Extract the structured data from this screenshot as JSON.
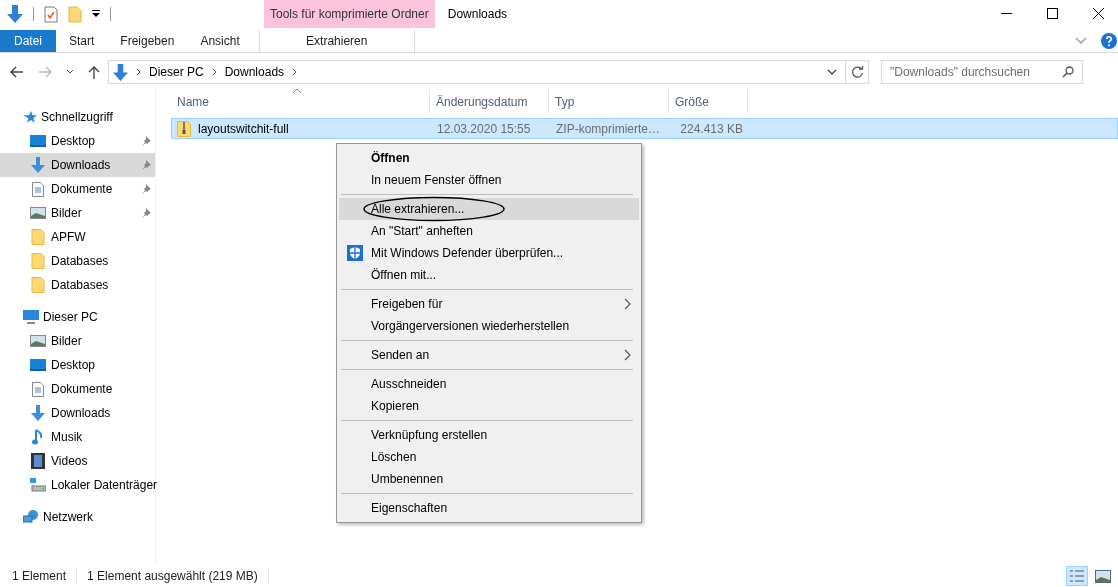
{
  "window": {
    "title": "Downloads"
  },
  "ribbon": {
    "tabs": [
      {
        "label": "Datei",
        "kind": "file",
        "selected": false
      },
      {
        "label": "Start",
        "kind": "tab",
        "selected": false
      },
      {
        "label": "Freigeben",
        "kind": "tab",
        "selected": false
      },
      {
        "label": "Ansicht",
        "kind": "tab",
        "selected": false
      }
    ],
    "contextual": {
      "group_label": "Tools für komprimierte Ordner",
      "tab": "Extrahieren"
    }
  },
  "address": {
    "path": [
      "Dieser PC",
      "Downloads"
    ]
  },
  "search": {
    "placeholder": "\"Downloads\" durchsuchen"
  },
  "sidebar": {
    "groups": [
      {
        "label": "Schnellzugriff",
        "kind": "star",
        "children": [
          {
            "label": "Desktop",
            "kind": "desktop",
            "pinned": true,
            "selected": false
          },
          {
            "label": "Downloads",
            "kind": "download",
            "pinned": true,
            "selected": true
          },
          {
            "label": "Dokumente",
            "kind": "document",
            "pinned": true,
            "selected": false
          },
          {
            "label": "Bilder",
            "kind": "pictures",
            "pinned": true,
            "selected": false
          },
          {
            "label": "APFW",
            "kind": "folder",
            "pinned": false,
            "selected": false
          },
          {
            "label": "Databases",
            "kind": "folder",
            "pinned": false,
            "selected": false
          },
          {
            "label": "Databases",
            "kind": "folder",
            "pinned": false,
            "selected": false
          }
        ]
      },
      {
        "label": "Dieser PC",
        "kind": "pc",
        "children": [
          {
            "label": "Bilder",
            "kind": "pictures",
            "pinned": false,
            "selected": false
          },
          {
            "label": "Desktop",
            "kind": "desktop",
            "pinned": false,
            "selected": false
          },
          {
            "label": "Dokumente",
            "kind": "document",
            "pinned": false,
            "selected": false
          },
          {
            "label": "Downloads",
            "kind": "download",
            "pinned": false,
            "selected": false
          },
          {
            "label": "Musik",
            "kind": "music",
            "pinned": false,
            "selected": false
          },
          {
            "label": "Videos",
            "kind": "video",
            "pinned": false,
            "selected": false
          },
          {
            "label": "Lokaler Datenträger",
            "kind": "drive",
            "pinned": false,
            "selected": false
          }
        ]
      },
      {
        "label": "Netzwerk",
        "kind": "network"
      }
    ]
  },
  "table": {
    "columns": [
      "Name",
      "Änderungsdatum",
      "Typ",
      "Größe"
    ],
    "rows": [
      {
        "name": "layoutswitchit-full",
        "date": "12.03.2020 15:55",
        "type": "ZIP-komprimierte…",
        "size": "224.413 KB",
        "selected": true
      }
    ]
  },
  "context_menu": {
    "items": [
      {
        "kind": "command",
        "label": "Öffnen",
        "default": true,
        "selected": false,
        "submenu": false,
        "circled": false
      },
      {
        "kind": "command",
        "label": "In neuem Fenster öffnen",
        "default": false,
        "selected": false,
        "submenu": false,
        "circled": false
      },
      {
        "kind": "separator"
      },
      {
        "kind": "command",
        "label": "Alle extrahieren...",
        "default": false,
        "selected": true,
        "submenu": false,
        "circled": true
      },
      {
        "kind": "command",
        "label": "An \"Start\" anheften",
        "default": false,
        "selected": false,
        "submenu": false,
        "circled": false
      },
      {
        "kind": "shield_command",
        "label": "Mit Windows Defender überprüfen...",
        "default": false,
        "selected": false,
        "submenu": false,
        "circled": false
      },
      {
        "kind": "command",
        "label": "Öffnen mit...",
        "default": false,
        "selected": false,
        "submenu": false,
        "circled": false
      },
      {
        "kind": "separator"
      },
      {
        "kind": "command",
        "label": "Freigeben für",
        "default": false,
        "selected": false,
        "submenu": true,
        "circled": false
      },
      {
        "kind": "command",
        "label": "Vorgängerversionen wiederherstellen",
        "default": false,
        "selected": false,
        "submenu": false,
        "circled": false
      },
      {
        "kind": "separator"
      },
      {
        "kind": "command",
        "label": "Senden an",
        "default": false,
        "selected": false,
        "submenu": true,
        "circled": false
      },
      {
        "kind": "separator"
      },
      {
        "kind": "command",
        "label": "Ausschneiden",
        "default": false,
        "selected": false,
        "submenu": false,
        "circled": false
      },
      {
        "kind": "command",
        "label": "Kopieren",
        "default": false,
        "selected": false,
        "submenu": false,
        "circled": false
      },
      {
        "kind": "separator"
      },
      {
        "kind": "command",
        "label": "Verknüpfung erstellen",
        "default": false,
        "selected": false,
        "submenu": false,
        "circled": false
      },
      {
        "kind": "command",
        "label": "Löschen",
        "default": false,
        "selected": false,
        "submenu": false,
        "circled": false
      },
      {
        "kind": "command",
        "label": "Umbenennen",
        "default": false,
        "selected": false,
        "submenu": false,
        "circled": false
      },
      {
        "kind": "separator"
      },
      {
        "kind": "command",
        "label": "Eigenschaften",
        "default": false,
        "selected": false,
        "submenu": false,
        "circled": false
      }
    ]
  },
  "status_bar": {
    "items": [
      "1 Element",
      "1 Element ausgewählt (219 MB)"
    ],
    "view_buttons": [
      {
        "kind": "details",
        "selected": true
      },
      {
        "kind": "tiles",
        "selected": false
      }
    ]
  }
}
